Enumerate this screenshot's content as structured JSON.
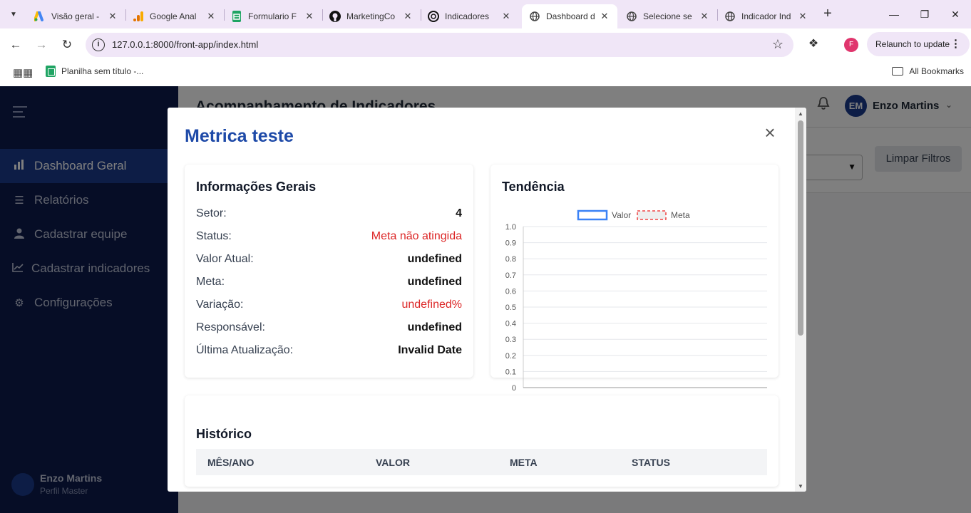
{
  "browser": {
    "tabs": [
      {
        "title": "Visão geral -",
        "icon": "google-ads-icon"
      },
      {
        "title": "Google Anal",
        "icon": "google-analytics-icon"
      },
      {
        "title": "Formulario F",
        "icon": "google-sheets-icon"
      },
      {
        "title": "MarketingCo",
        "icon": "github-icon"
      },
      {
        "title": "Indicadores",
        "icon": "openai-icon"
      },
      {
        "title": "Dashboard d",
        "icon": "globe-icon"
      },
      {
        "title": "Selecione se",
        "icon": "globe-icon"
      },
      {
        "title": "Indicador Ind",
        "icon": "globe-icon"
      }
    ],
    "url": "127.0.0.1:8000/front-app/index.html",
    "relaunch_label": "Relaunch to update",
    "profile_initial": "F",
    "bookmark": "Planilha sem título -...",
    "all_bookmarks": "All Bookmarks"
  },
  "sidebar": {
    "items": [
      {
        "label": "Dashboard Geral",
        "icon": "bar-chart-icon"
      },
      {
        "label": "Relatórios",
        "icon": "list-icon"
      },
      {
        "label": "Cadastrar equipe",
        "icon": "user-icon"
      },
      {
        "label": "Cadastrar indicadores",
        "icon": "line-chart-icon"
      },
      {
        "label": "Configurações",
        "icon": "gear-icon"
      }
    ],
    "user_name": "Enzo Martins",
    "user_role": "Perfil Master"
  },
  "header": {
    "title": "Acompanhamento de Indicadores",
    "avatar_initials": "EM",
    "user_name": "Enzo Martins"
  },
  "filters": {
    "clear_label": "Limpar Filtros"
  },
  "modal": {
    "title": "Metrica teste",
    "info": {
      "title": "Informações Gerais",
      "rows": [
        {
          "label": "Setor:",
          "value": "4"
        },
        {
          "label": "Status:",
          "value": "Meta não atingida"
        },
        {
          "label": "Valor Atual:",
          "value": "undefined"
        },
        {
          "label": "Meta:",
          "value": "undefined"
        },
        {
          "label": "Variação:",
          "value": "undefined%"
        },
        {
          "label": "Responsável:",
          "value": "undefined"
        },
        {
          "label": "Última Atualização:",
          "value": "Invalid Date"
        }
      ]
    },
    "trend": {
      "title": "Tendência"
    },
    "history": {
      "title": "Histórico",
      "columns": [
        "MÊS/ANO",
        "VALOR",
        "META",
        "STATUS"
      ]
    }
  },
  "colors": {
    "sidebar_bg": "#0d1b4c",
    "accent": "#1a3a8c",
    "modal_title": "#1e4aa8",
    "status_red": "#dc2626",
    "series_valor": "#3b82f6",
    "series_meta": "#ef4444"
  },
  "chart_data": {
    "type": "line",
    "x": [],
    "series": [
      {
        "name": "Valor",
        "values": [],
        "style": "solid"
      },
      {
        "name": "Meta",
        "values": [],
        "style": "dashed"
      }
    ],
    "yticks": [
      "1.0",
      "0.9",
      "0.8",
      "0.7",
      "0.6",
      "0.5",
      "0.4",
      "0.3",
      "0.2",
      "0.1",
      "0"
    ],
    "ylim": [
      0,
      1
    ],
    "grid": true,
    "legend": "top"
  }
}
